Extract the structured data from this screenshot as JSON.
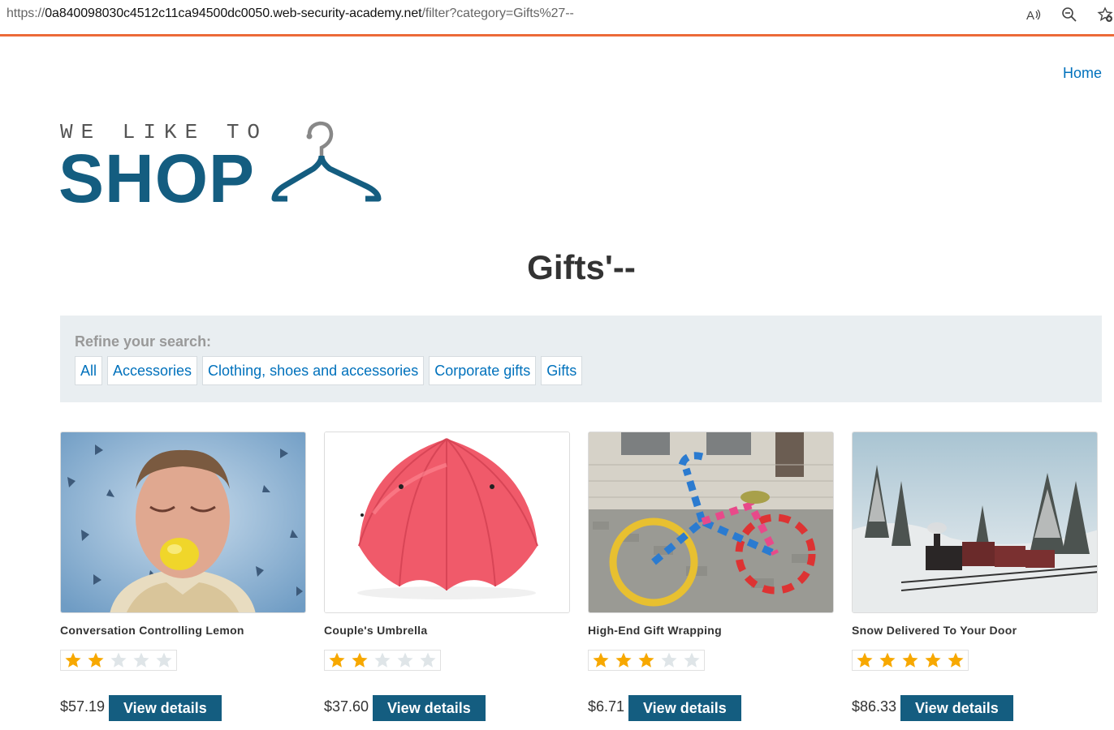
{
  "browser": {
    "url_proto": "https://",
    "url_host": "0a840098030c4512c11ca94500dc0050.web-security-academy.net",
    "url_path": "/filter?category=Gifts%27--"
  },
  "nav": {
    "home_label": "Home"
  },
  "logo": {
    "top_text": "WE LIKE TO",
    "main_text": "SHOP"
  },
  "page_title": "Gifts'--",
  "filters": {
    "label": "Refine your search:",
    "items": [
      "All",
      "Accessories",
      "Clothing, shoes and accessories",
      "Corporate gifts",
      "Gifts"
    ]
  },
  "products": [
    {
      "name": "Conversation Controlling Lemon",
      "rating": 2,
      "price": "$57.19",
      "button": "View details"
    },
    {
      "name": "Couple's Umbrella",
      "rating": 2,
      "price": "$37.60",
      "button": "View details"
    },
    {
      "name": "High-End Gift Wrapping",
      "rating": 3,
      "price": "$6.71",
      "button": "View details"
    },
    {
      "name": "Snow Delivered To Your Door",
      "rating": 5,
      "price": "$86.33",
      "button": "View details"
    }
  ],
  "colors": {
    "brand": "#145d80",
    "link": "#0071bc",
    "accent_line": "#ec6a38",
    "star_filled": "#f7a800",
    "star_empty": "#dfe5e8"
  }
}
